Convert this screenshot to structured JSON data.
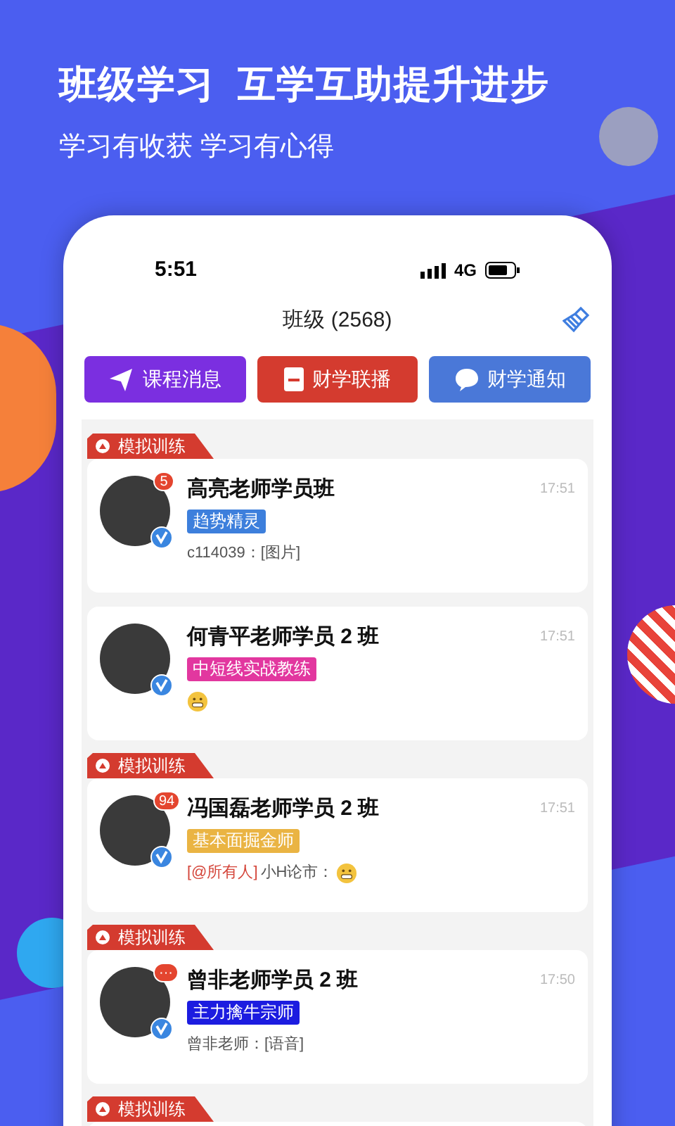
{
  "headline": "班级学习  互学互助提升进步",
  "subheadline": "学习有收获 学习有心得",
  "status_bar": {
    "time": "5:51",
    "network": "4G"
  },
  "title": "班级 (2568)",
  "buttons": [
    {
      "label": "课程消息",
      "kind": "send"
    },
    {
      "label": "财学联播",
      "kind": "doc"
    },
    {
      "label": "财学通知",
      "kind": "chat"
    }
  ],
  "groups": [
    {
      "banner": "模拟训练",
      "name": "高亮老师学员班",
      "badge": "5",
      "tag": "趋势精灵",
      "color": "#3d7fdc",
      "time": "17:51",
      "message": {
        "text": "c114039：[图片]",
        "emoji": false
      }
    },
    {
      "name": "何青平老师学员 2 班",
      "tag": "中短线实战教练",
      "color": "#e2379f",
      "time": "17:51",
      "message": {
        "emoji": true
      }
    },
    {
      "banner": "模拟训练",
      "name": "冯国磊老师学员 2 班",
      "badge": "94",
      "tag": "基本面掘金师",
      "color": "#eab443",
      "time": "17:51",
      "message": {
        "mention": "[@所有人]",
        "text": "小H论市：",
        "emoji": true
      }
    },
    {
      "banner": "模拟训练",
      "name": "曾非老师学员 2 班",
      "badge": "···",
      "tag": "主力擒牛宗师",
      "color": "#1c1ce0",
      "time": "17:50",
      "message": {
        "text": "曾非老师：[语音]",
        "emoji": false
      }
    }
  ],
  "next_banner": "模拟训练"
}
